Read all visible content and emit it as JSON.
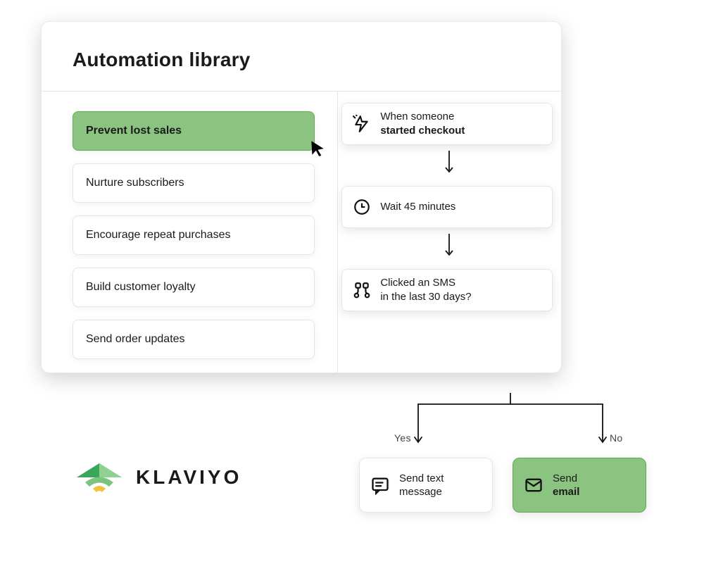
{
  "panel_title": "Automation library",
  "list": [
    {
      "label": "Prevent lost sales",
      "active": true
    },
    {
      "label": "Nurture subscribers",
      "active": false
    },
    {
      "label": "Encourage repeat purchases",
      "active": false
    },
    {
      "label": "Build customer loyalty",
      "active": false
    },
    {
      "label": "Send order updates",
      "active": false
    }
  ],
  "flow": {
    "trigger_prefix": "When someone",
    "trigger_strong": "started checkout",
    "wait": "Wait 45 minutes",
    "split": "Clicked an SMS\nin the last 30 days?"
  },
  "branch": {
    "yes_label": "Yes",
    "no_label": "No",
    "yes_action_line1": "Send text",
    "yes_action_line2": "message",
    "no_action_line1": "Send",
    "no_action_strong": "email"
  },
  "brand": "KLAVIYO"
}
